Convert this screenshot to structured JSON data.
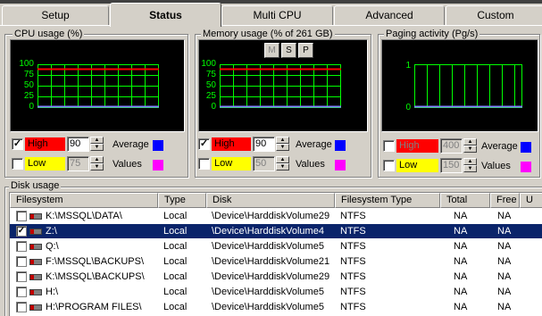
{
  "tabs": [
    "Setup",
    "Status",
    "Multi CPU",
    "Advanced",
    "Custom"
  ],
  "active_tab": "Status",
  "cpu": {
    "title": "CPU usage (%)",
    "y_ticks": [
      "100",
      "75",
      "50",
      "25",
      "0"
    ],
    "high_label": "High",
    "high_value": "90",
    "high_checked": true,
    "low_label": "Low",
    "low_value": "75",
    "low_checked": false,
    "average_label": "Average",
    "values_label": "Values"
  },
  "memory": {
    "title": "Memory usage (% of 261 GB)",
    "buttons": [
      "M",
      "S",
      "P"
    ],
    "y_ticks": [
      "100",
      "75",
      "50",
      "25",
      "0"
    ],
    "high_label": "High",
    "high_value": "90",
    "high_checked": true,
    "low_label": "Low",
    "low_value": "50",
    "low_checked": false,
    "average_label": "Average",
    "values_label": "Values"
  },
  "paging": {
    "title": "Paging activity (Pg/s)",
    "y_ticks": [
      "1",
      "0"
    ],
    "high_label": "High",
    "high_value": "400",
    "high_checked": false,
    "low_label": "Low",
    "low_value": "150",
    "low_checked": false,
    "average_label": "Average",
    "values_label": "Values"
  },
  "disk": {
    "title": "Disk usage",
    "columns": [
      "Filesystem",
      "Type",
      "Disk",
      "Filesystem Type",
      "Total",
      "Free",
      "U"
    ],
    "rows": [
      {
        "checked": false,
        "selected": false,
        "filesystem": "K:\\MSSQL\\DATA\\",
        "type": "Local",
        "disk": "\\Device\\HarddiskVolume29",
        "fstype": "NTFS",
        "total": "NA",
        "free": "NA"
      },
      {
        "checked": true,
        "selected": true,
        "filesystem": "Z:\\",
        "type": "Local",
        "disk": "\\Device\\HarddiskVolume4",
        "fstype": "NTFS",
        "total": "NA",
        "free": "NA"
      },
      {
        "checked": false,
        "selected": false,
        "filesystem": "Q:\\",
        "type": "Local",
        "disk": "\\Device\\HarddiskVolume5",
        "fstype": "NTFS",
        "total": "NA",
        "free": "NA"
      },
      {
        "checked": false,
        "selected": false,
        "filesystem": "F:\\MSSQL\\BACKUPS\\",
        "type": "Local",
        "disk": "\\Device\\HarddiskVolume21",
        "fstype": "NTFS",
        "total": "NA",
        "free": "NA"
      },
      {
        "checked": false,
        "selected": false,
        "filesystem": "K:\\MSSQL\\BACKUPS\\",
        "type": "Local",
        "disk": "\\Device\\HarddiskVolume29",
        "fstype": "NTFS",
        "total": "NA",
        "free": "NA"
      },
      {
        "checked": false,
        "selected": false,
        "filesystem": "H:\\",
        "type": "Local",
        "disk": "\\Device\\HarddiskVolume5",
        "fstype": "NTFS",
        "total": "NA",
        "free": "NA"
      },
      {
        "checked": false,
        "selected": false,
        "filesystem": "H:\\PROGRAM FILES\\",
        "type": "Local",
        "disk": "\\Device\\HarddiskVolume5",
        "fstype": "NTFS",
        "total": "NA",
        "free": "NA"
      }
    ]
  },
  "colors": {
    "high": "#ff0000",
    "low": "#ffff00",
    "average": "#0000ff",
    "values": "#ff00ff",
    "grid": "#00ff00",
    "high_line": "#ff0000",
    "avg_line": "#8080ff"
  },
  "icons": {
    "row_icon": "drive-icon",
    "spin": "spin-arrows-icon"
  }
}
